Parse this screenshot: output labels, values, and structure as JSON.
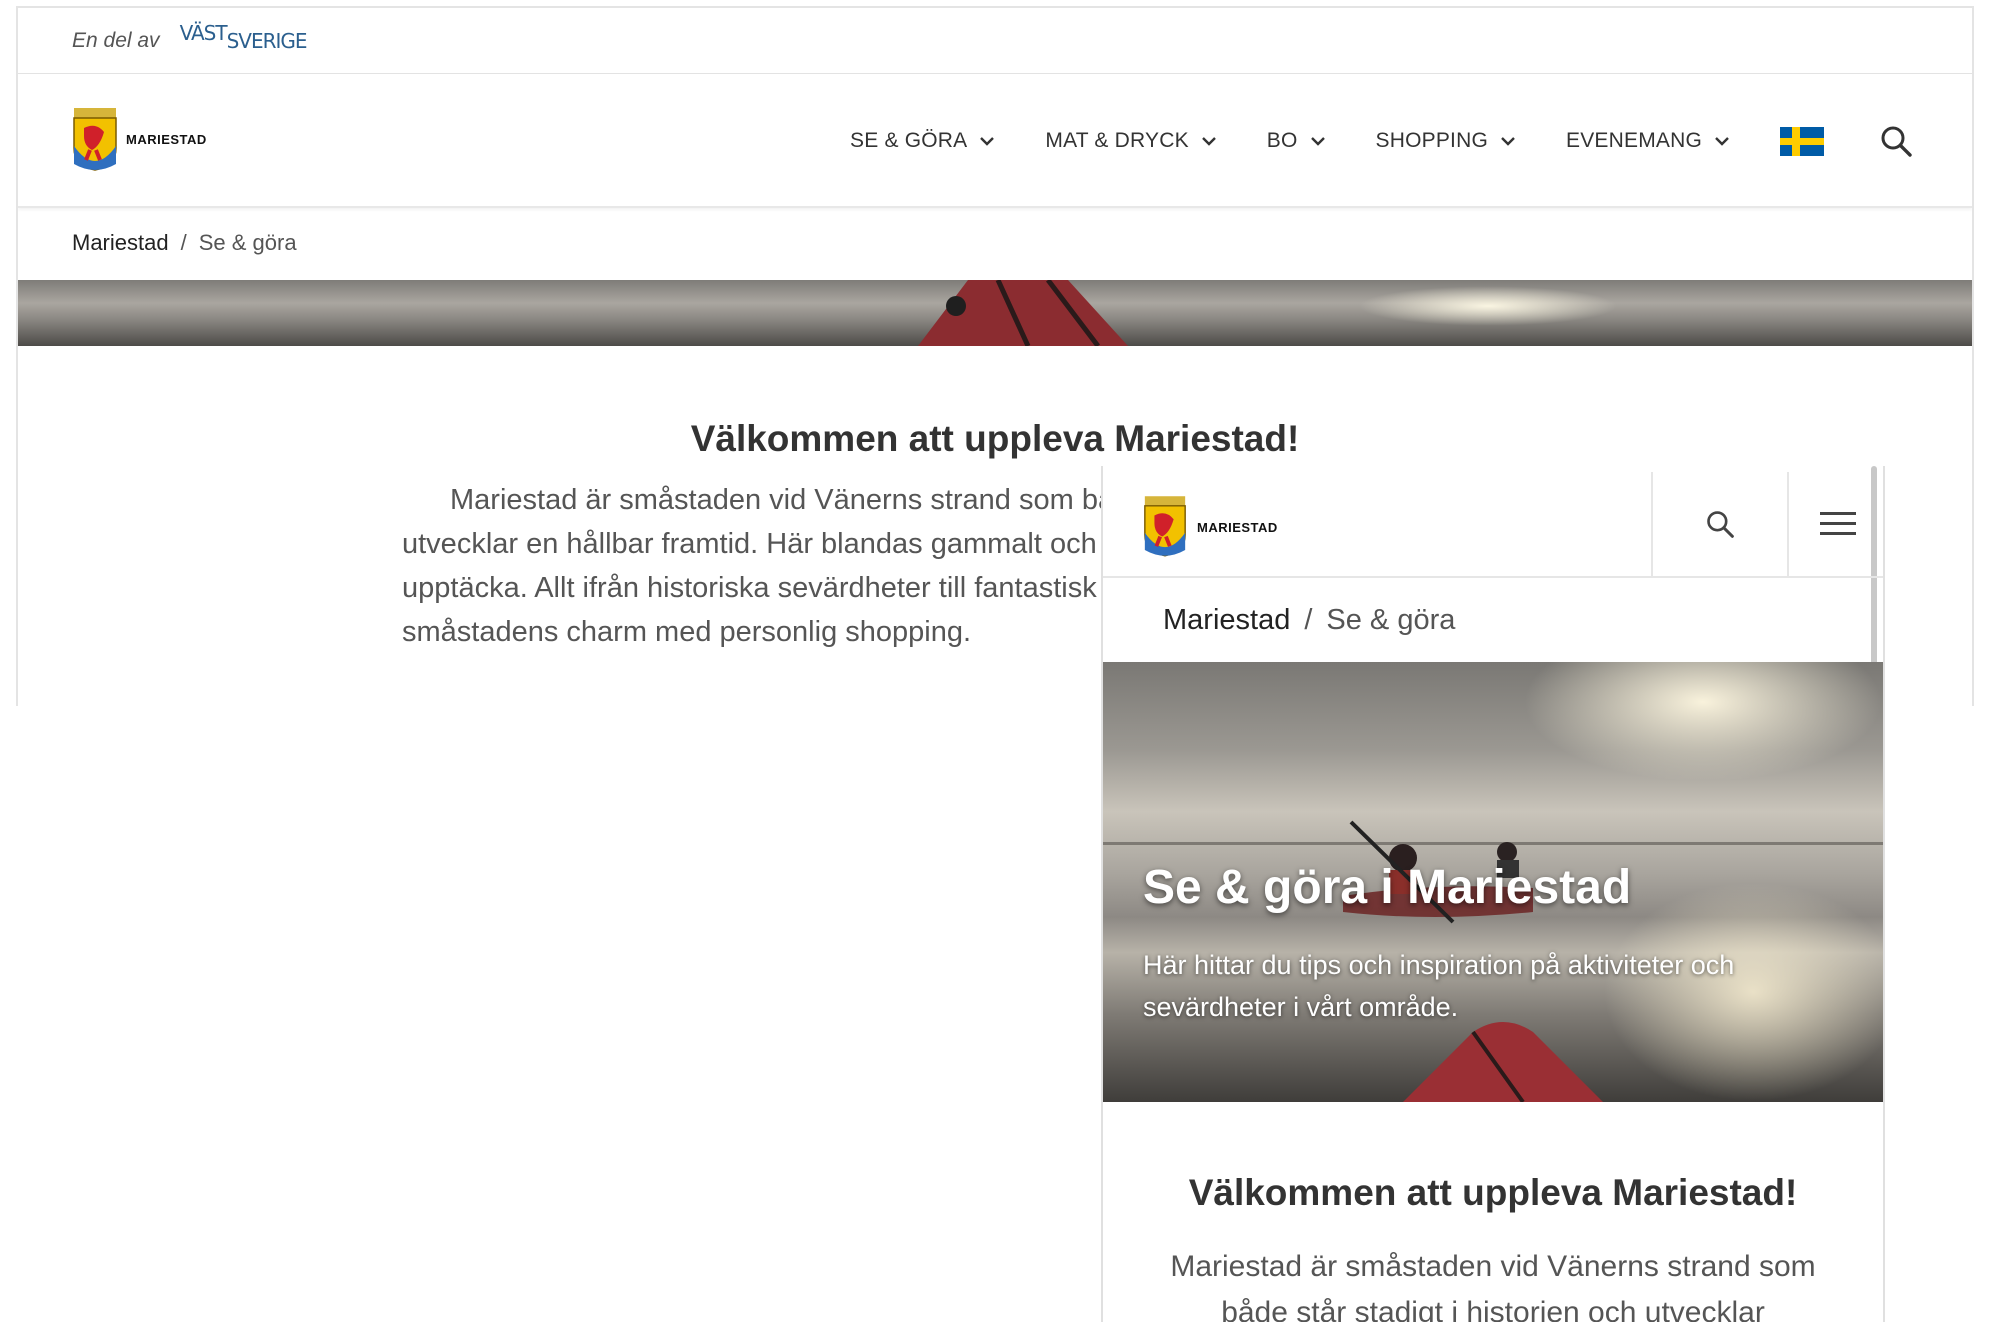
{
  "desktop": {
    "topbar": {
      "part_of": "En del av",
      "partner_logo_top": "VÄST",
      "partner_logo_bottom": "SVERIGE"
    },
    "brand": "MARIESTAD",
    "nav": [
      {
        "label": "SE & GÖRA"
      },
      {
        "label": "MAT & DRYCK"
      },
      {
        "label": "BO"
      },
      {
        "label": "SHOPPING"
      },
      {
        "label": "EVENEMANG"
      }
    ],
    "breadcrumb": {
      "home": "Mariestad",
      "separator": "/",
      "current": "Se & göra"
    },
    "heading": "Välkommen att uppleva Mariestad!",
    "paragraph": "Mariestad är småstaden vid Vänerns strand som både står stadigt i historien och utvecklar en hållbar framtid. Här blandas gammalt och nytt och det finns mycket att upptäcka. Allt ifrån historiska sevärdheter till fantastisk natur, aktiviteter på land och småstadens charm med personlig shopping."
  },
  "mobile": {
    "brand": "MARIESTAD",
    "breadcrumb": {
      "home": "Mariestad",
      "separator": "/",
      "current": "Se & göra"
    },
    "hero": {
      "title": "Se & göra i Mariestad",
      "text": "Här hittar du tips och inspiration på aktiviteter och sevärdheter i vårt område."
    },
    "heading": "Välkommen att uppleva Mariestad!",
    "paragraph": "Mariestad är småstaden vid Vänerns strand som både står stadigt i historien och utvecklar"
  },
  "icons": {
    "search": "search-icon",
    "chevron": "chevron-down-icon",
    "menu": "hamburger-menu-icon",
    "flag": "swedish-flag-icon",
    "crest": "mariestad-crest-logo"
  },
  "colors": {
    "flag_blue": "#005ba6",
    "flag_yellow": "#fecc00",
    "partner_blue": "#2b5f8e",
    "text": "#333333"
  }
}
